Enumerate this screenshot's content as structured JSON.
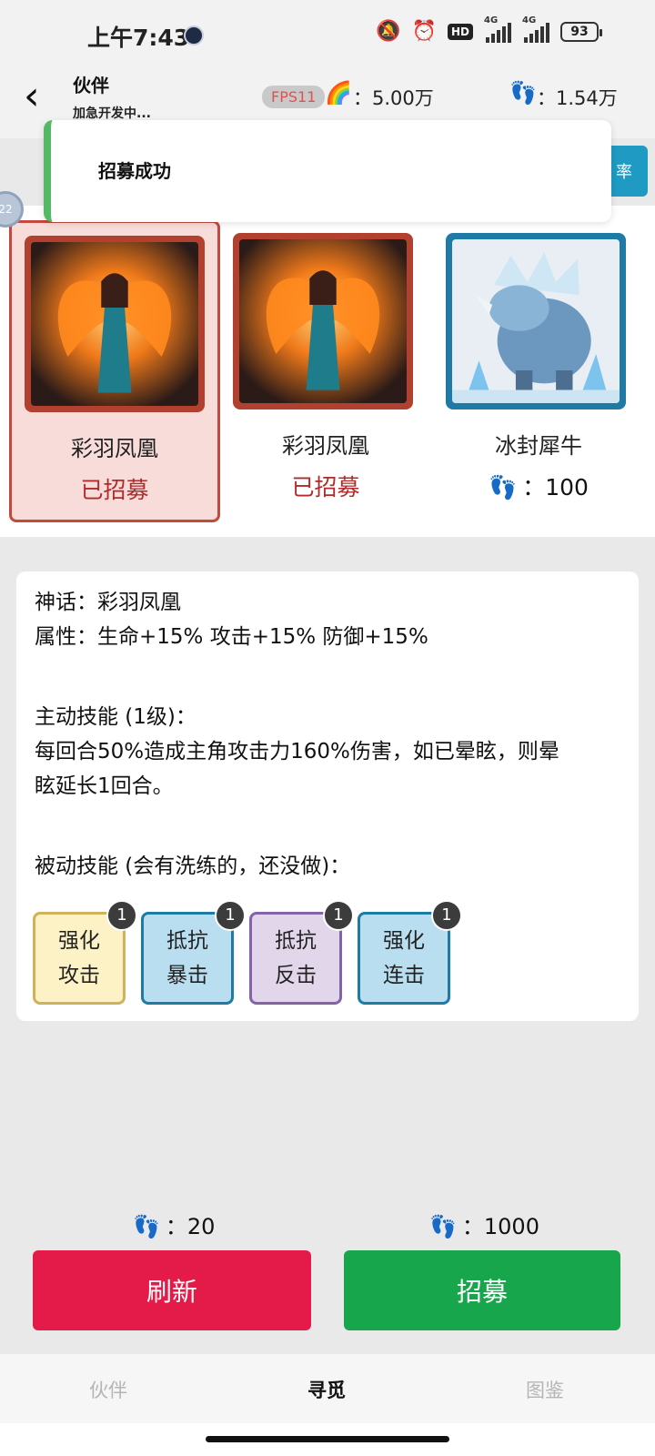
{
  "status_bar": {
    "time": "上午7:43",
    "network1": "4G",
    "network2": "4G",
    "hd": "HD",
    "battery": "93"
  },
  "header": {
    "title": "伙伴",
    "subtitle": "加急开发中...",
    "fps": "FPS11",
    "currency1": "：5.00万",
    "currency2": "：1.54万"
  },
  "toast": {
    "message": "招募成功"
  },
  "rate_button": {
    "label": "率"
  },
  "edge_bubble": {
    "label": "22"
  },
  "cards": [
    {
      "name": "彩羽凤凰",
      "status": "已招募"
    },
    {
      "name": "彩羽凤凰",
      "status": "已招募"
    },
    {
      "name": "冰封犀牛",
      "cost": "：100"
    }
  ],
  "detail": {
    "myth": "神话：彩羽凤凰",
    "attributes": "属性：生命+15% 攻击+15% 防御+15%",
    "active_title": "主动技能 (1级)：",
    "active_desc_1": "每回合50%造成主角攻击力160%伤害，如已晕眩，则晕",
    "active_desc_2": "眩延长1回合。",
    "passive_title": "被动技能 (会有洗练的，还没做)："
  },
  "skills": [
    {
      "label": "强化攻击",
      "level": "1",
      "color": "#fdf1c6"
    },
    {
      "label": "抵抗暴击",
      "level": "1",
      "color": "#b9def0"
    },
    {
      "label": "抵抗反击",
      "level": "1",
      "color": "#e2d6eb"
    },
    {
      "label": "强化连击",
      "level": "1",
      "color": "#b9def0"
    }
  ],
  "costs": {
    "refresh_cost": "：20",
    "recruit_cost": "：1000"
  },
  "buttons": {
    "refresh": "刷新",
    "recruit": "招募"
  },
  "nav": {
    "tab1": "伙伴",
    "tab2": "寻觅",
    "tab3": "图鉴"
  },
  "icons": {
    "back": "back-arrow-icon",
    "currency1": "rainbow-icon",
    "currency2": "footprints-icon",
    "cost": "footprints-icon"
  },
  "colors": {
    "refresh_button": "#e41b48",
    "recruit_button": "#17a64c",
    "recruited_text": "#b02b2b",
    "toast_accent": "#54b866"
  }
}
